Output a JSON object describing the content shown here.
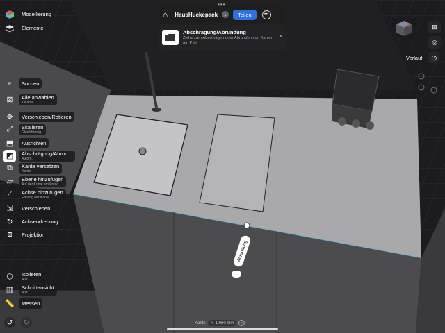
{
  "app": {
    "project_name": "HausHuckepack",
    "share_label": "Teilen",
    "history_label": "Verlauf"
  },
  "tip": {
    "title": "Abschrägung/Abrundung",
    "description": "Ziehe zum Abschrägen oder Abrunden von Kanten am Pfeil"
  },
  "sidebar_top": [
    {
      "label": "Modellierung",
      "icon": "cube-stack-icon"
    },
    {
      "label": "Elemente",
      "icon": "layers-icon"
    }
  ],
  "tools": [
    {
      "label": "Suchen",
      "sub": "",
      "icon": "search-icon"
    },
    {
      "label": "Alle abwählen",
      "sub": "1 Kante",
      "icon": "deselect-icon"
    },
    {
      "label": "Verschieben/Rotieren",
      "sub": "",
      "icon": "move-rotate-icon"
    },
    {
      "label": "Skalieren",
      "sub": "Gleichförmig",
      "icon": "scale-icon"
    },
    {
      "label": "Ausrichten",
      "sub": "",
      "icon": "align-icon"
    },
    {
      "label": "Abschrägung/Abrun...",
      "sub": "Autom.",
      "icon": "bevel-icon"
    },
    {
      "label": "Kante versetzen",
      "sub": "Kante",
      "icon": "offset-edge-icon"
    },
    {
      "label": "Ebene hinzufügen",
      "sub": "Auf der Kurve am Punkt",
      "icon": "add-plane-icon"
    },
    {
      "label": "Achse hinzufügen",
      "sub": "Entlang der Kante",
      "icon": "add-axis-icon"
    },
    {
      "label": "Verschieben",
      "sub": "",
      "icon": "move-icon"
    },
    {
      "label": "Achsendrehung",
      "sub": "",
      "icon": "axis-rotation-icon"
    },
    {
      "label": "Projektion",
      "sub": "",
      "icon": "projection-icon"
    }
  ],
  "tools_bottom": [
    {
      "label": "Isolieren",
      "sub": "Aus",
      "icon": "isolate-icon"
    },
    {
      "label": "Schnittansicht",
      "sub": "Aus",
      "icon": "section-view-icon"
    },
    {
      "label": "Messen",
      "sub": "",
      "icon": "measure-icon"
    }
  ],
  "viewport": {
    "handle_label": "Abrundung",
    "status_label": "Kante",
    "status_value": "1.660 mm"
  }
}
